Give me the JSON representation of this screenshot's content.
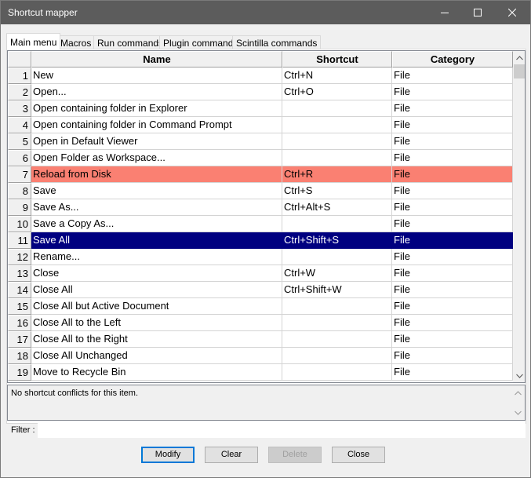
{
  "window": {
    "title": "Shortcut mapper"
  },
  "tabs": [
    {
      "label": "Main menu",
      "active": true
    },
    {
      "label": "Macros",
      "active": false
    },
    {
      "label": "Run commands",
      "active": false
    },
    {
      "label": "Plugin commands",
      "active": false
    },
    {
      "label": "Scintilla commands",
      "active": false
    }
  ],
  "grid": {
    "headers": {
      "name": "Name",
      "shortcut": "Shortcut",
      "category": "Category"
    },
    "rows": [
      {
        "num": "1",
        "name": "New",
        "shortcut": "Ctrl+N",
        "category": "File"
      },
      {
        "num": "2",
        "name": "Open...",
        "shortcut": "Ctrl+O",
        "category": "File"
      },
      {
        "num": "3",
        "name": "Open containing folder in Explorer",
        "shortcut": "",
        "category": "File"
      },
      {
        "num": "4",
        "name": "Open containing folder in Command Prompt",
        "shortcut": "",
        "category": "File"
      },
      {
        "num": "5",
        "name": "Open in Default Viewer",
        "shortcut": "",
        "category": "File"
      },
      {
        "num": "6",
        "name": "Open Folder as Workspace...",
        "shortcut": "",
        "category": "File"
      },
      {
        "num": "7",
        "name": "Reload from Disk",
        "shortcut": "Ctrl+R",
        "category": "File",
        "state": "conflict"
      },
      {
        "num": "8",
        "name": "Save",
        "shortcut": "Ctrl+S",
        "category": "File"
      },
      {
        "num": "9",
        "name": "Save As...",
        "shortcut": "Ctrl+Alt+S",
        "category": "File"
      },
      {
        "num": "10",
        "name": "Save a Copy As...",
        "shortcut": "",
        "category": "File"
      },
      {
        "num": "11",
        "name": "Save All",
        "shortcut": "Ctrl+Shift+S",
        "category": "File",
        "state": "selected"
      },
      {
        "num": "12",
        "name": "Rename...",
        "shortcut": "",
        "category": "File"
      },
      {
        "num": "13",
        "name": "Close",
        "shortcut": "Ctrl+W",
        "category": "File"
      },
      {
        "num": "14",
        "name": "Close All",
        "shortcut": "Ctrl+Shift+W",
        "category": "File"
      },
      {
        "num": "15",
        "name": "Close All but Active Document",
        "shortcut": "",
        "category": "File"
      },
      {
        "num": "16",
        "name": "Close All to the Left",
        "shortcut": "",
        "category": "File"
      },
      {
        "num": "17",
        "name": "Close All to the Right",
        "shortcut": "",
        "category": "File"
      },
      {
        "num": "18",
        "name": "Close All Unchanged",
        "shortcut": "",
        "category": "File"
      },
      {
        "num": "19",
        "name": "Move to Recycle Bin",
        "shortcut": "",
        "category": "File"
      }
    ]
  },
  "conflict_info": {
    "text": "No shortcut conflicts for this item."
  },
  "filter": {
    "label": "Filter :",
    "value": ""
  },
  "buttons": {
    "modify": "Modify",
    "clear": "Clear",
    "delete": "Delete",
    "close": "Close"
  },
  "colors": {
    "conflict_row": "#fa8072",
    "selected_row": "#000080",
    "titlebar": "#5c5c5c"
  },
  "icons": {
    "minimize": "minimize-icon",
    "maximize": "maximize-icon",
    "close": "close-icon",
    "scroll_up": "chevron-up-icon",
    "scroll_down": "chevron-down-icon"
  }
}
